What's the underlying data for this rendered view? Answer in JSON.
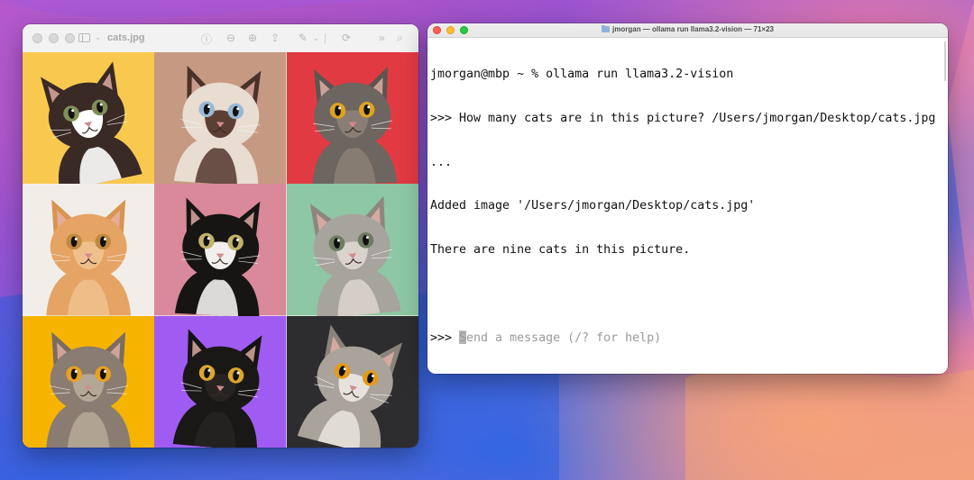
{
  "wallpaper": {
    "colors": [
      "#c34fb7",
      "#8d55d8",
      "#3e68e4",
      "#e07ab6",
      "#f2a07e"
    ]
  },
  "preview": {
    "title": "cats.jpg",
    "toolbar_icons": [
      "sidebar-icon",
      "info-icon",
      "zoom-out-icon",
      "zoom-in-icon",
      "share-icon",
      "markup-icon",
      "rotate-icon",
      "more-icon",
      "search-icon"
    ],
    "image": {
      "cells": [
        {
          "bg": "#f9c94f",
          "fur": "#3a2a26",
          "face": "#ffffff",
          "eyes": "#7e8f5a",
          "ears": "#3a2a26"
        },
        {
          "bg": "#c69a82",
          "fur": "#e9ddd1",
          "face": "#5b3f35",
          "eyes": "#9ab8d6",
          "ears": "#4a3229"
        },
        {
          "bg": "#e23a43",
          "fur": "#6d6560",
          "face": "#8a7e74",
          "eyes": "#e0a320",
          "ears": "#5d5550"
        },
        {
          "bg": "#f1eeea",
          "fur": "#e5a464",
          "face": "#f0c08c",
          "eyes": "#c28a3e",
          "ears": "#d99452"
        },
        {
          "bg": "#d9899a",
          "fur": "#161514",
          "face": "#f2f0ee",
          "eyes": "#c4b26a",
          "ears": "#161514"
        },
        {
          "bg": "#8dc7a3",
          "fur": "#a7a39d",
          "face": "#d9d3cb",
          "eyes": "#6f7c62",
          "ears": "#8d877f"
        },
        {
          "bg": "#f6b400",
          "fur": "#8a7c70",
          "face": "#b3a796",
          "eyes": "#e8a21d",
          "ears": "#7a6c61"
        },
        {
          "bg": "#a05cf2",
          "fur": "#1a1817",
          "face": "#262321",
          "eyes": "#dca62e",
          "ears": "#151313"
        },
        {
          "bg": "#2d2c2f",
          "fur": "#aaa39b",
          "face": "#e6e2dc",
          "eyes": "#e49a1a",
          "ears": "#8a837b"
        }
      ]
    }
  },
  "terminal": {
    "title": "jmorgan — ollama run llama3.2-vision — 71×23",
    "lines": [
      "jmorgan@mbp ~ % ollama run llama3.2-vision",
      ">>> How many cats are in this picture? /Users/jmorgan/Desktop/cats.jpg",
      "...",
      "Added image '/Users/jmorgan/Desktop/cats.jpg'",
      "There are nine cats in this picture.",
      ""
    ],
    "prompt": ">>> ",
    "input_placeholder": "Send a message (/? for help)"
  }
}
